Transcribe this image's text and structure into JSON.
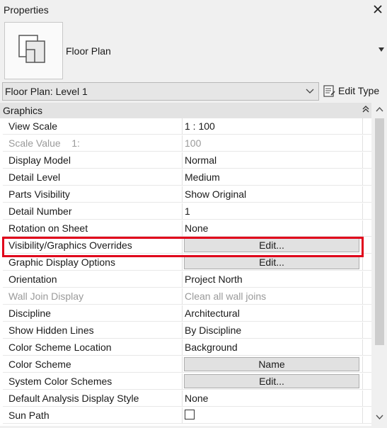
{
  "window": {
    "title": "Properties"
  },
  "type_selector": {
    "type_name": "Floor Plan"
  },
  "instance_selector": {
    "value": "Floor Plan: Level 1",
    "edit_type_label": "Edit Type"
  },
  "group": {
    "label": "Graphics"
  },
  "rows": [
    {
      "name": "View Scale",
      "value": "1 : 100"
    },
    {
      "name": "Scale Value    1:",
      "value": "100"
    },
    {
      "name": "Display Model",
      "value": "Normal"
    },
    {
      "name": "Detail Level",
      "value": "Medium"
    },
    {
      "name": "Parts Visibility",
      "value": "Show Original"
    },
    {
      "name": "Detail Number",
      "value": "1"
    },
    {
      "name": "Rotation on Sheet",
      "value": "None"
    },
    {
      "name": "Visibility/Graphics Overrides",
      "value": "Edit..."
    },
    {
      "name": "Graphic Display Options",
      "value": "Edit..."
    },
    {
      "name": "Orientation",
      "value": "Project North"
    },
    {
      "name": "Wall Join Display",
      "value": "Clean all wall joins"
    },
    {
      "name": "Discipline",
      "value": "Architectural"
    },
    {
      "name": "Show Hidden Lines",
      "value": "By Discipline"
    },
    {
      "name": "Color Scheme Location",
      "value": "Background"
    },
    {
      "name": "Color Scheme",
      "value": "Name"
    },
    {
      "name": "System Color Schemes",
      "value": "Edit..."
    },
    {
      "name": "Default Analysis Display Style",
      "value": "None"
    },
    {
      "name": "Sun Path",
      "value": ""
    }
  ],
  "sun_path_checked": false,
  "colors": {
    "highlight": "#e0001a",
    "disabled_text": "#9a9a9a",
    "group_header_bg": "#e3e3e3"
  }
}
